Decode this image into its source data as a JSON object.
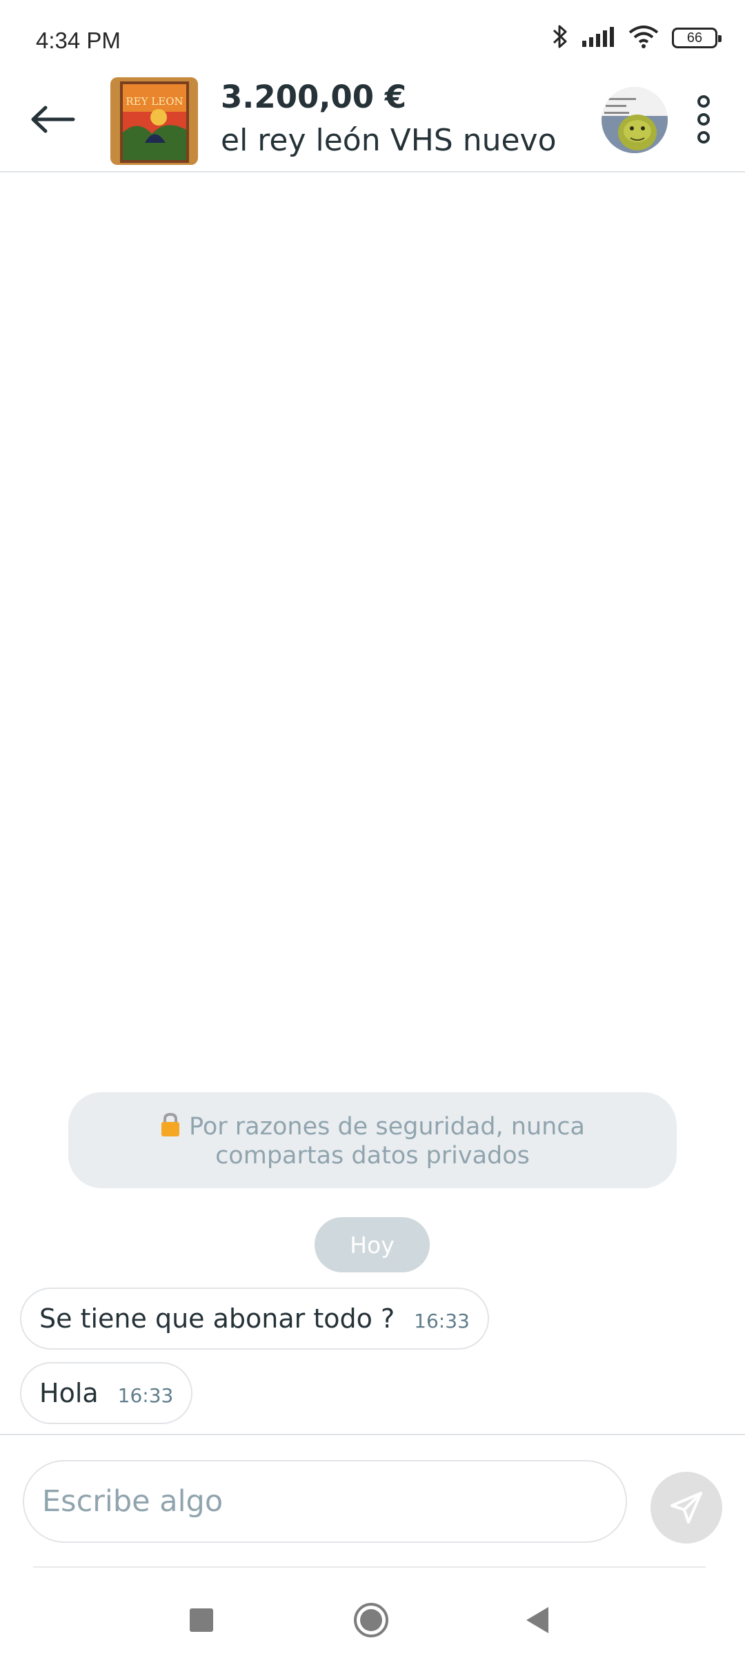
{
  "status_bar": {
    "time": "4:34 PM",
    "battery_level": "66",
    "icons": [
      "bluetooth-icon",
      "signal-icon",
      "wifi-icon",
      "battery-icon"
    ]
  },
  "header": {
    "price": "3.200,00 €",
    "title": "el rey león VHS nuevo",
    "thumbnail_title_text": "REY LEON"
  },
  "chat": {
    "security_notice": {
      "line1": "Por razones de seguridad, nunca",
      "line2": "compartas datos privados"
    },
    "date_separator": "Hoy",
    "messages": [
      {
        "text": "Se tiene que abonar todo ?",
        "time": "16:33"
      },
      {
        "text": "Hola",
        "time": "16:33"
      }
    ]
  },
  "composer": {
    "placeholder": "Escribe algo"
  },
  "colors": {
    "text_primary": "#253238",
    "notice_bg": "#e9edf0",
    "date_chip_bg": "#cfd8dc",
    "send_button_bg": "#e0e0e0"
  }
}
